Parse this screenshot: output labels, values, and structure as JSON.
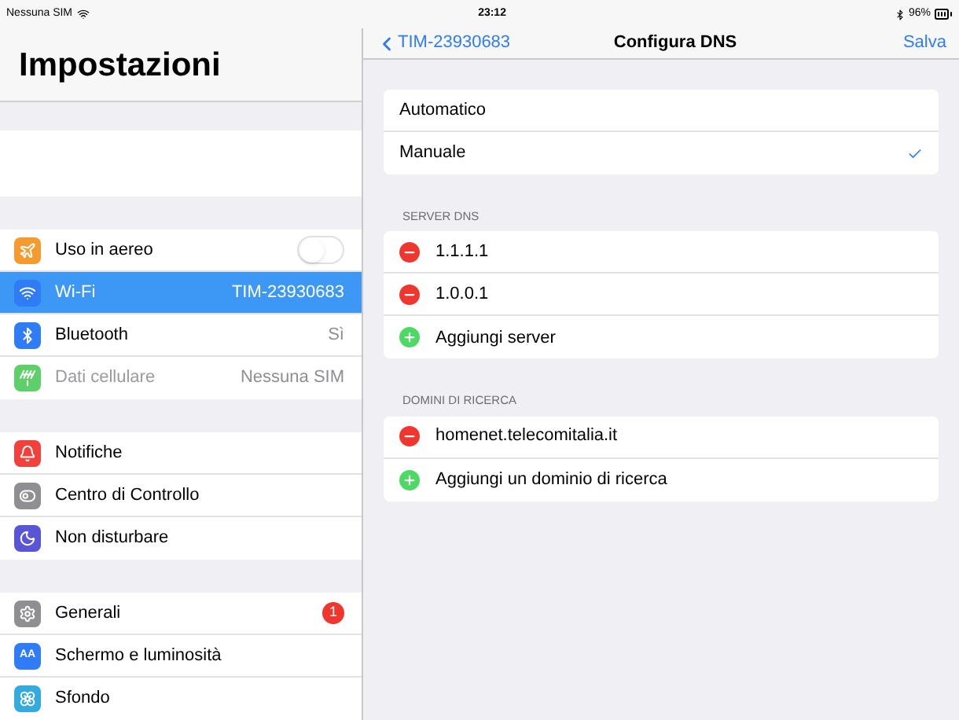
{
  "status_bar": {
    "carrier": "Nessuna SIM",
    "time": "23:12",
    "battery": "96%"
  },
  "sidebar": {
    "title": "Impostazioni",
    "groups": [
      [
        {
          "label": "Uso in aereo",
          "kind": "toggle",
          "on": false,
          "selected": false,
          "disabled": false,
          "color": "#f59a2f"
        },
        {
          "label": "Wi-Fi",
          "kind": "value",
          "value": "TIM-23930683",
          "selected": true,
          "disabled": false,
          "color": "#2f7cf6"
        },
        {
          "label": "Bluetooth",
          "kind": "value",
          "value": "Sì",
          "selected": false,
          "disabled": false,
          "color": "#2f7cf6"
        },
        {
          "label": "Dati cellulare",
          "kind": "value",
          "value": "Nessuna SIM",
          "selected": false,
          "disabled": true,
          "color": "#5fcf6a"
        }
      ],
      [
        {
          "label": "Notifiche",
          "kind": "plain",
          "selected": false,
          "disabled": false,
          "color": "#f2413a"
        },
        {
          "label": "Centro di Controllo",
          "kind": "plain",
          "selected": false,
          "disabled": false,
          "color": "#8e8e93"
        },
        {
          "label": "Non disturbare",
          "kind": "plain",
          "selected": false,
          "disabled": false,
          "color": "#5856d6"
        }
      ],
      [
        {
          "label": "Generali",
          "kind": "badge",
          "badge": "1",
          "selected": false,
          "disabled": false,
          "color": "#8e8e93"
        },
        {
          "label": "Schermo e luminosità",
          "kind": "plain",
          "icon_text": "AA",
          "selected": false,
          "disabled": false,
          "color": "#2f7cf6"
        },
        {
          "label": "Sfondo",
          "kind": "plain",
          "selected": false,
          "disabled": false,
          "color": "#35aadc"
        }
      ]
    ]
  },
  "nav": {
    "back": "TIM-23930683",
    "title": "Configura DNS",
    "action": "Salva"
  },
  "mode_options": [
    {
      "label": "Automatico",
      "selected": false
    },
    {
      "label": "Manuale",
      "selected": true
    }
  ],
  "sections": [
    {
      "header": "SERVER DNS",
      "items": [
        {
          "label": "1.1.1.1",
          "kind": "remove"
        },
        {
          "label": "1.0.0.1",
          "kind": "remove"
        },
        {
          "label": "Aggiungi server",
          "kind": "add"
        }
      ]
    },
    {
      "header": "DOMINI DI RICERCA",
      "items": [
        {
          "label": "homenet.telecomitalia.it",
          "kind": "remove"
        },
        {
          "label": "Aggiungi un dominio di ricerca",
          "kind": "add"
        }
      ]
    }
  ]
}
